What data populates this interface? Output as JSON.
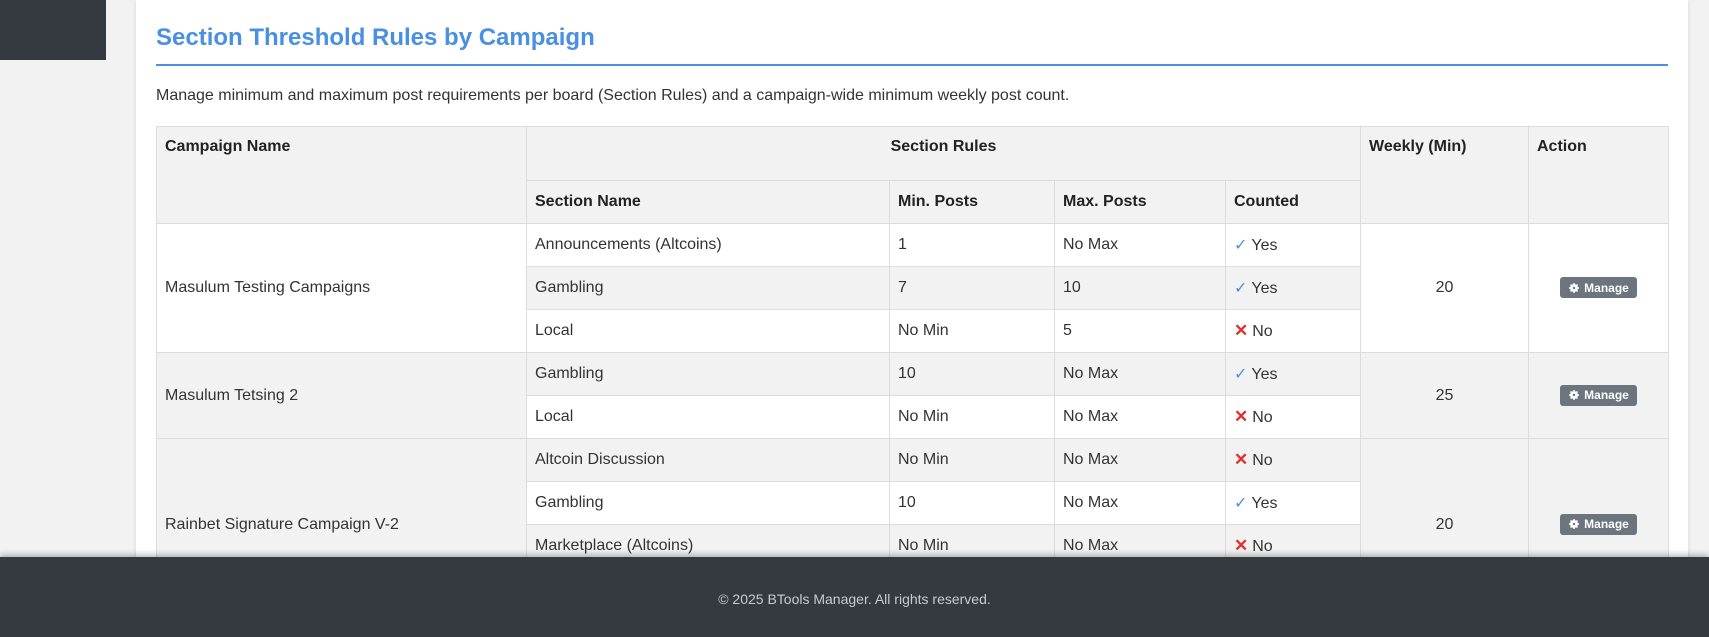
{
  "page": {
    "title": "Section Threshold Rules by Campaign",
    "description": "Manage minimum and maximum post requirements per board (Section Rules) and a campaign-wide minimum weekly post count."
  },
  "table": {
    "headers": {
      "campaign": "Campaign Name",
      "section_rules": "Section Rules",
      "weekly": "Weekly (Min)",
      "action": "Action",
      "section_name": "Section Name",
      "min_posts": "Min. Posts",
      "max_posts": "Max. Posts",
      "counted": "Counted"
    },
    "campaigns": [
      {
        "name": "Masulum Testing Campaigns",
        "weekly": "20",
        "action": "Manage",
        "rules": [
          {
            "section": "Announcements (Altcoins)",
            "min": "1",
            "max": "No Max",
            "counted": "Yes"
          },
          {
            "section": "Gambling",
            "min": "7",
            "max": "10",
            "counted": "Yes"
          },
          {
            "section": "Local",
            "min": "No Min",
            "max": "5",
            "counted": "No"
          }
        ]
      },
      {
        "name": "Masulum Tetsing 2",
        "weekly": "25",
        "action": "Manage",
        "rules": [
          {
            "section": "Gambling",
            "min": "10",
            "max": "No Max",
            "counted": "Yes"
          },
          {
            "section": "Local",
            "min": "No Min",
            "max": "No Max",
            "counted": "No"
          }
        ]
      },
      {
        "name": "Rainbet Signature Campaign V-2",
        "weekly": "20",
        "action": "Manage",
        "rules": [
          {
            "section": "Altcoin Discussion",
            "min": "No Min",
            "max": "No Max",
            "counted": "No"
          },
          {
            "section": "Gambling",
            "min": "10",
            "max": "No Max",
            "counted": "Yes"
          },
          {
            "section": "Marketplace (Altcoins)",
            "min": "No Min",
            "max": "No Max",
            "counted": "No"
          },
          {
            "section": "",
            "min": "",
            "max": "",
            "counted": ""
          }
        ]
      }
    ]
  },
  "icons": {
    "counted_yes": "check-icon",
    "counted_no": "cross-icon",
    "manage": "gear-icon"
  },
  "colors": {
    "accent": "#4a90e2",
    "no": "#e0302e",
    "button": "#6c757d",
    "footer": "#343a40"
  },
  "footer": {
    "text": "© 2025 BTools Manager. All rights reserved."
  }
}
